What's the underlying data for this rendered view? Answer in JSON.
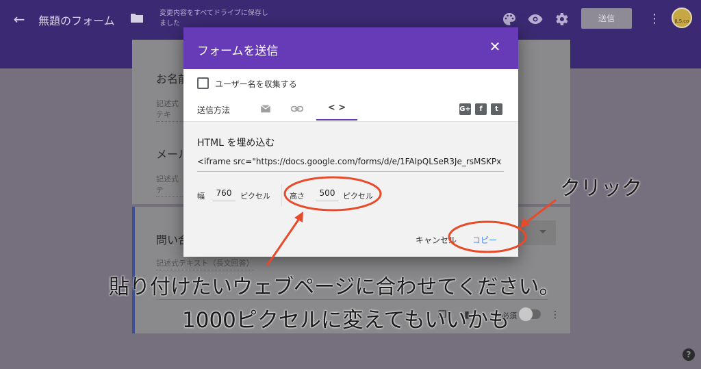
{
  "header": {
    "title": "無題のフォーム",
    "save_status": "変更内容をすべてドライブに保存しました",
    "send_label": "送信",
    "avatar_text": "JLS.co"
  },
  "form_background": {
    "q1_title": "お名前",
    "q1_sub": "記述式テキ",
    "q2_title": "メール",
    "q2_sub": "記述式テ",
    "q3_title": "問い合",
    "q3_sub": "記述式テキスト（長文回答）",
    "required_label": "必須"
  },
  "dialog": {
    "title": "フォームを送信",
    "collect_username_label": "ユーザー名を収集する",
    "send_method_label": "送信方法",
    "embed_title": "HTML を埋め込む",
    "embed_code": "<iframe src=\"https://docs.google.com/forms/d/e/1FAIpQLSeR3Je_rsMSKPx",
    "width_label": "幅",
    "width_value": "760",
    "width_unit": "ピクセル",
    "height_label": "高さ",
    "height_value": "500",
    "height_unit": "ピクセル",
    "cancel_label": "キャンセル",
    "copy_label": "コピー",
    "social": [
      "G+",
      "f",
      "t"
    ]
  },
  "annotations": {
    "click_label": "クリック",
    "instruction_line1": "貼り付けたいウェブページに合わせてください。",
    "instruction_line2": "1000ピクセルに変えてもいいかも",
    "color": "#e84a2a"
  }
}
